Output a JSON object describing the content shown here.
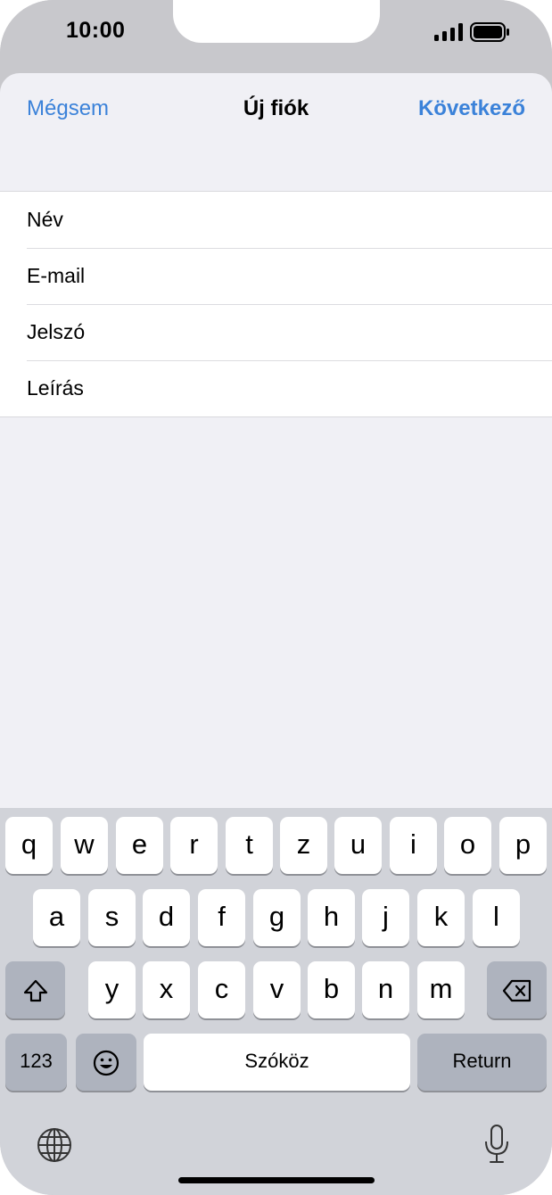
{
  "status_bar": {
    "time": "10:00",
    "icons": [
      "cellular-signal-icon",
      "battery-icon"
    ]
  },
  "nav": {
    "cancel_label": "Mégsem",
    "title": "Új fiók",
    "next_label": "Következő"
  },
  "form": {
    "fields": [
      {
        "placeholder": "Név"
      },
      {
        "placeholder": "E-mail"
      },
      {
        "placeholder": "Jelszó"
      },
      {
        "placeholder": "Leírás"
      }
    ]
  },
  "keyboard": {
    "row1": [
      "q",
      "w",
      "e",
      "r",
      "t",
      "z",
      "u",
      "i",
      "o",
      "p"
    ],
    "row2": [
      "a",
      "s",
      "d",
      "f",
      "g",
      "h",
      "j",
      "k",
      "l"
    ],
    "row3": [
      "y",
      "x",
      "c",
      "v",
      "b",
      "n",
      "m"
    ],
    "numbers_label": "123",
    "space_label": "Szóköz",
    "return_label": "Return",
    "icons": [
      "shift-icon",
      "delete-icon",
      "emoji-icon",
      "globe-icon",
      "microphone-icon"
    ]
  },
  "colors": {
    "accent": "#3b82d9",
    "sheet_background": "#f0f0f5",
    "keyboard_background": "#d1d3d9",
    "function_key": "#aeb3be"
  }
}
